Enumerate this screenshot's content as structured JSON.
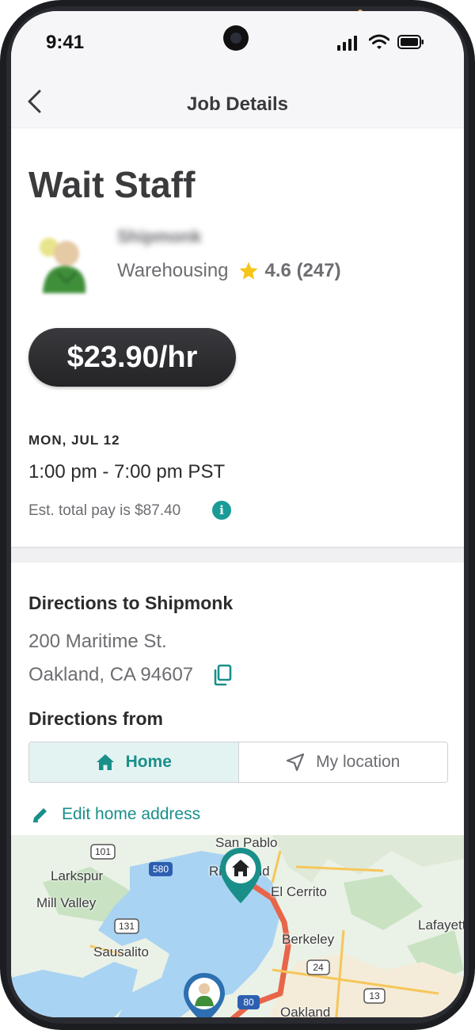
{
  "status_bar": {
    "time": "9:41"
  },
  "nav": {
    "title": "Job Details",
    "back_icon": "chevron-left-icon"
  },
  "job": {
    "title": "Wait Staff",
    "company": "Shipmonk",
    "category": "Warehousing",
    "rating": "4.6 (247)",
    "pay": "$23.90/hr",
    "date": "MON, JUL 12",
    "hours": "1:00 pm - 7:00 pm  PST",
    "est_total": "Est. total pay is $87.40"
  },
  "directions": {
    "title": "Directions to Shipmonk",
    "address_line1": "200 Maritime St.",
    "address_line2": "Oakland, CA 94607",
    "from_title": "Directions from",
    "options": [
      {
        "label": "Home",
        "icon": "home-icon",
        "active": true
      },
      {
        "label": "My location",
        "icon": "navigation-arrow-icon",
        "active": false
      }
    ],
    "edit_label": "Edit home address"
  },
  "map": {
    "labels": [
      "San Pablo",
      "Larkspur",
      "Mill Valley",
      "Richmond",
      "El Cerrito",
      "Berkeley",
      "Sausalito",
      "Lafayette",
      "Oakland"
    ],
    "shields": [
      "101",
      "580",
      "131",
      "24",
      "13",
      "80"
    ],
    "route_color": "#e8654a",
    "water_color": "#a9d3f2",
    "land_color": "#eaf1e6",
    "park_color": "#c8e2c2",
    "marker_color": "#1a8f8a"
  },
  "colors": {
    "accent": "#1a8f8a",
    "pill": "#2d2d30",
    "star": "#f5c518"
  }
}
